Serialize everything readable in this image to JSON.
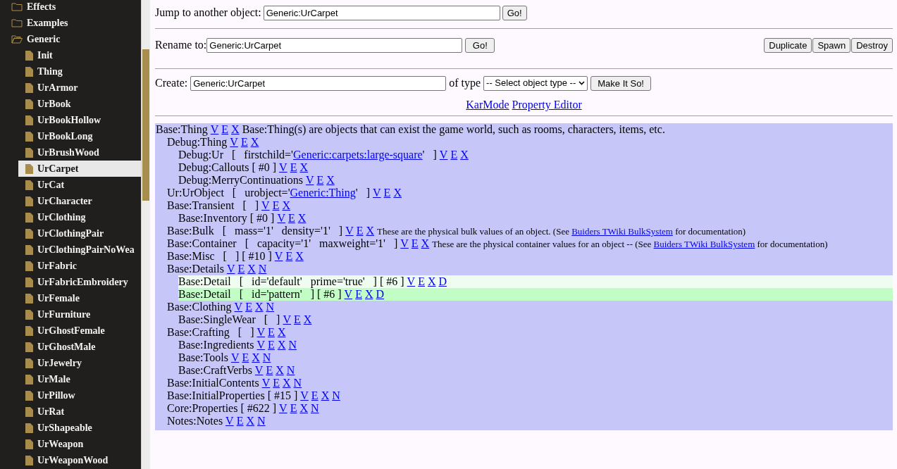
{
  "sidebar": {
    "items": [
      {
        "label": "Effects",
        "kind": "folder",
        "expanded": false,
        "selected": false
      },
      {
        "label": "Examples",
        "kind": "folder",
        "expanded": false,
        "selected": false
      },
      {
        "label": "Generic",
        "kind": "folder",
        "expanded": true,
        "selected": false,
        "children": [
          {
            "label": "Init",
            "kind": "file",
            "selected": false
          },
          {
            "label": "Thing",
            "kind": "file",
            "selected": false
          },
          {
            "label": "UrArmor",
            "kind": "file",
            "selected": false
          },
          {
            "label": "UrBook",
            "kind": "file",
            "selected": false
          },
          {
            "label": "UrBookHollow",
            "kind": "file",
            "selected": false
          },
          {
            "label": "UrBookLong",
            "kind": "file",
            "selected": false
          },
          {
            "label": "UrBrushWood",
            "kind": "file",
            "selected": false
          },
          {
            "label": "UrCarpet",
            "kind": "file",
            "selected": true
          },
          {
            "label": "UrCat",
            "kind": "file",
            "selected": false
          },
          {
            "label": "UrCharacter",
            "kind": "file",
            "selected": false
          },
          {
            "label": "UrClothing",
            "kind": "file",
            "selected": false
          },
          {
            "label": "UrClothingPair",
            "kind": "file",
            "selected": false
          },
          {
            "label": "UrClothingPairNoWea",
            "kind": "file",
            "selected": false
          },
          {
            "label": "UrFabric",
            "kind": "file",
            "selected": false
          },
          {
            "label": "UrFabricEmbroidery",
            "kind": "file",
            "selected": false
          },
          {
            "label": "UrFemale",
            "kind": "file",
            "selected": false
          },
          {
            "label": "UrFurniture",
            "kind": "file",
            "selected": false
          },
          {
            "label": "UrGhostFemale",
            "kind": "file",
            "selected": false
          },
          {
            "label": "UrGhostMale",
            "kind": "file",
            "selected": false
          },
          {
            "label": "UrJewelry",
            "kind": "file",
            "selected": false
          },
          {
            "label": "UrMale",
            "kind": "file",
            "selected": false
          },
          {
            "label": "UrPillow",
            "kind": "file",
            "selected": false
          },
          {
            "label": "UrRat",
            "kind": "file",
            "selected": false
          },
          {
            "label": "UrShapeable",
            "kind": "file",
            "selected": false
          },
          {
            "label": "UrWeapon",
            "kind": "file",
            "selected": false
          },
          {
            "label": "UrWeaponWood",
            "kind": "file",
            "selected": false
          }
        ]
      }
    ]
  },
  "jump": {
    "label": "Jump to another object:",
    "value": "Generic:UrCarpet",
    "button": "Go!"
  },
  "rename": {
    "label": "Rename to:",
    "value": "Generic:UrCarpet",
    "button": "Go!",
    "actions": [
      "Duplicate",
      "Spawn",
      "Destroy"
    ]
  },
  "create": {
    "label": "Create:",
    "value": "Generic:UrCarpet",
    "type_label": "of type",
    "select": "-- Select object type --",
    "button": "Make It So!"
  },
  "links": [
    "KarMode",
    "Property Editor"
  ],
  "properties": [
    {
      "segments": [
        {
          "kind": "text",
          "text": "Base:Thing"
        }
      ],
      "actions": [
        "V",
        "E",
        "X"
      ],
      "note": [
        {
          "kind": "text",
          "text": "Base:Thing(s) are objects that can exist the game world, such as rooms, characters, items, etc."
        }
      ],
      "note_small": false,
      "children": [
        {
          "segments": [
            {
              "kind": "text",
              "text": "Debug:Thing"
            }
          ],
          "actions": [
            "V",
            "E",
            "X"
          ],
          "children": [
            {
              "segments": [
                {
                  "kind": "text",
                  "text": "Debug:Ur   [   firstchild='"
                },
                {
                  "kind": "link",
                  "text": "Generic:carpets:large-square"
                },
                {
                  "kind": "text",
                  "text": "'   ]"
                }
              ],
              "actions": [
                "V",
                "E",
                "X"
              ]
            },
            {
              "segments": [
                {
                  "kind": "text",
                  "text": "Debug:Callouts [ #0 ]"
                }
              ],
              "actions": [
                "V",
                "E",
                "X"
              ]
            },
            {
              "segments": [
                {
                  "kind": "text",
                  "text": "Debug:MerryContinuations"
                }
              ],
              "actions": [
                "V",
                "E",
                "X"
              ]
            }
          ]
        },
        {
          "segments": [
            {
              "kind": "text",
              "text": "Ur:UrObject   [   urobject='"
            },
            {
              "kind": "link",
              "text": "Generic:Thing"
            },
            {
              "kind": "text",
              "text": "'   ]"
            }
          ],
          "actions": [
            "V",
            "E",
            "X"
          ]
        },
        {
          "segments": [
            {
              "kind": "text",
              "text": "Base:Transient   [   ]"
            }
          ],
          "actions": [
            "V",
            "E",
            "X"
          ],
          "children": [
            {
              "segments": [
                {
                  "kind": "text",
                  "text": "Base:Inventory [ #0 ]"
                }
              ],
              "actions": [
                "V",
                "E",
                "X"
              ]
            }
          ]
        },
        {
          "segments": [
            {
              "kind": "text",
              "text": "Base:Bulk   [   mass='1'   density='1'   ]"
            }
          ],
          "actions": [
            "V",
            "E",
            "X"
          ],
          "note": [
            {
              "kind": "text",
              "text": "These are the physical bulk values of an object. (See "
            },
            {
              "kind": "link",
              "text": "Buiders TWiki BulkSystem"
            },
            {
              "kind": "text",
              "text": " for documentation)"
            }
          ],
          "note_small": true
        },
        {
          "segments": [
            {
              "kind": "text",
              "text": "Base:Container   [   capacity='1'   maxweight='1'   ]"
            }
          ],
          "actions": [
            "V",
            "E",
            "X"
          ],
          "note": [
            {
              "kind": "text",
              "text": "These are the physical container values for an object -- (See "
            },
            {
              "kind": "link",
              "text": "Buiders TWiki BulkSystem"
            },
            {
              "kind": "text",
              "text": " for documentation)"
            }
          ],
          "note_small": true
        },
        {
          "segments": [
            {
              "kind": "text",
              "text": "Base:Misc   [   ] [ #10 ]"
            }
          ],
          "actions": [
            "V",
            "E",
            "X"
          ]
        },
        {
          "segments": [
            {
              "kind": "text",
              "text": "Base:Details"
            }
          ],
          "actions": [
            "V",
            "E",
            "X",
            "N"
          ],
          "children": [
            {
              "segments": [
                {
                  "kind": "text",
                  "text": "Base:Detail   [   id='default'   prime='true'   ] [ #6 ]"
                }
              ],
              "actions": [
                "V",
                "E",
                "X",
                "D"
              ],
              "highlighted": true,
              "selected": false
            },
            {
              "segments": [
                {
                  "kind": "text",
                  "text": "Base:Detail   [   id='pattern'   ] [ #6 ]"
                }
              ],
              "actions": [
                "V",
                "E",
                "X",
                "D"
              ],
              "highlighted": true,
              "selected": true
            }
          ]
        },
        {
          "segments": [
            {
              "kind": "text",
              "text": "Base:Clothing"
            }
          ],
          "actions": [
            "V",
            "E",
            "X",
            "N"
          ],
          "children": [
            {
              "segments": [
                {
                  "kind": "text",
                  "text": "Base:SingleWear   [   ]"
                }
              ],
              "actions": [
                "V",
                "E",
                "X"
              ]
            }
          ]
        },
        {
          "segments": [
            {
              "kind": "text",
              "text": "Base:Crafting   [   ]"
            }
          ],
          "actions": [
            "V",
            "E",
            "X"
          ],
          "children": [
            {
              "segments": [
                {
                  "kind": "text",
                  "text": "Base:Ingredients"
                }
              ],
              "actions": [
                "V",
                "E",
                "X",
                "N"
              ]
            },
            {
              "segments": [
                {
                  "kind": "text",
                  "text": "Base:Tools"
                }
              ],
              "actions": [
                "V",
                "E",
                "X",
                "N"
              ]
            },
            {
              "segments": [
                {
                  "kind": "text",
                  "text": "Base:CraftVerbs"
                }
              ],
              "actions": [
                "V",
                "E",
                "X",
                "N"
              ]
            }
          ]
        },
        {
          "segments": [
            {
              "kind": "text",
              "text": "Base:InitialContents"
            }
          ],
          "actions": [
            "V",
            "E",
            "X",
            "N"
          ]
        },
        {
          "segments": [
            {
              "kind": "text",
              "text": "Base:InitialProperties [ #15 ]"
            }
          ],
          "actions": [
            "V",
            "E",
            "X",
            "N"
          ]
        },
        {
          "segments": [
            {
              "kind": "text",
              "text": "Core:Properties [ #622 ]"
            }
          ],
          "actions": [
            "V",
            "E",
            "X",
            "N"
          ]
        },
        {
          "segments": [
            {
              "kind": "text",
              "text": "Notes:Notes"
            }
          ],
          "actions": [
            "V",
            "E",
            "X",
            "N"
          ]
        }
      ]
    }
  ]
}
